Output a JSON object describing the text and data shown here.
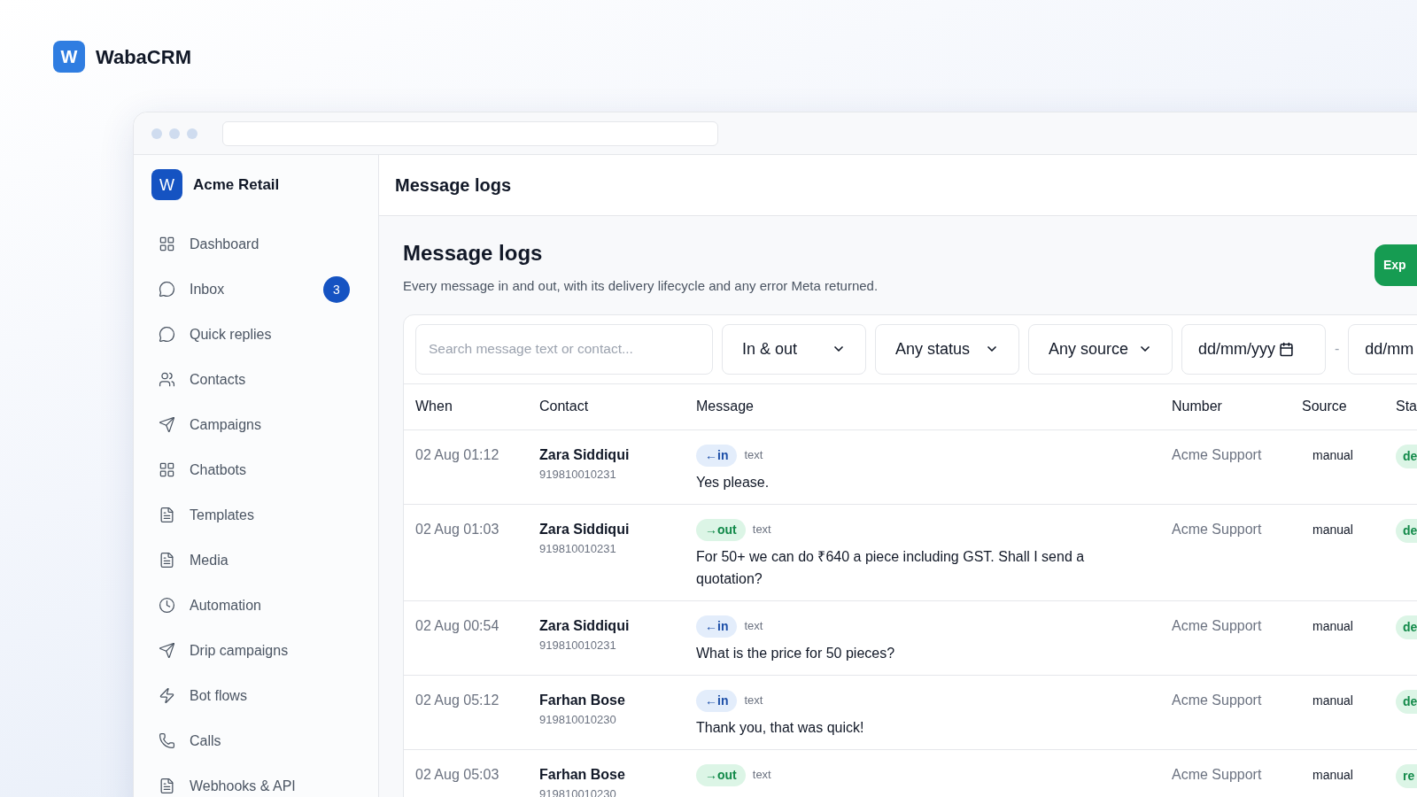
{
  "brand": {
    "name": "WabaCRM",
    "mark": "W"
  },
  "sidebar": {
    "workspace": {
      "mark": "W",
      "name": "Acme Retail"
    },
    "items": [
      {
        "label": "Dashboard",
        "kind": "grid"
      },
      {
        "label": "Inbox",
        "kind": "chat",
        "badge": "3"
      },
      {
        "label": "Quick replies",
        "kind": "chat"
      },
      {
        "label": "Contacts",
        "kind": "users"
      },
      {
        "label": "Campaigns",
        "kind": "send"
      },
      {
        "label": "Chatbots",
        "kind": "grid"
      },
      {
        "label": "Templates",
        "kind": "file"
      },
      {
        "label": "Media",
        "kind": "file"
      },
      {
        "label": "Automation",
        "kind": "clock"
      },
      {
        "label": "Drip campaigns",
        "kind": "send"
      },
      {
        "label": "Bot flows",
        "kind": "zap"
      },
      {
        "label": "Calls",
        "kind": "phone"
      },
      {
        "label": "Webhooks & API",
        "kind": "file"
      }
    ]
  },
  "topbar": {
    "title": "Message logs"
  },
  "page": {
    "title": "Message logs",
    "subtitle": "Every message in and out, with its delivery lifecycle and any error Meta returned.",
    "export_button": "Exp"
  },
  "filters": {
    "search": {
      "placeholder": "Search message text or contact..."
    },
    "selects": [
      "In & out",
      "Any status",
      "Any source"
    ],
    "date_from": "dd/mm/yyy",
    "separator": "-",
    "date_to": "dd/mm"
  },
  "table": {
    "columns": [
      "When",
      "Contact",
      "Message",
      "Number",
      "Source",
      "Sta"
    ],
    "rows": [
      {
        "when": "02 Aug 01:12",
        "contact": "Zara Siddiqui",
        "phone": "919810010231",
        "direction": {
          "kind": "in",
          "label": "←in"
        },
        "type": "text",
        "message": "Yes please.",
        "number": "Acme Support",
        "source": "manual",
        "status": "de"
      },
      {
        "when": "02 Aug 01:03",
        "contact": "Zara Siddiqui",
        "phone": "919810010231",
        "direction": {
          "kind": "out",
          "label": "→out"
        },
        "type": "text",
        "message": "For 50+ we can do ₹640 a piece including GST. Shall I send a quotation?",
        "number": "Acme Support",
        "source": "manual",
        "status": "de"
      },
      {
        "when": "02 Aug 00:54",
        "contact": "Zara Siddiqui",
        "phone": "919810010231",
        "direction": {
          "kind": "in",
          "label": "←in"
        },
        "type": "text",
        "message": "What is the price for 50 pieces?",
        "number": "Acme Support",
        "source": "manual",
        "status": "de"
      },
      {
        "when": "02 Aug 05:12",
        "contact": "Farhan Bose",
        "phone": "919810010230",
        "direction": {
          "kind": "in",
          "label": "←in"
        },
        "type": "text",
        "message": "Thank you, that was quick!",
        "number": "Acme Support",
        "source": "manual",
        "status": "de"
      },
      {
        "when": "02 Aug 05:03",
        "contact": "Farhan Bose",
        "phone": "919810010230",
        "direction": {
          "kind": "out",
          "label": "→out"
        },
        "type": "text",
        "number": "Acme Support",
        "source": "manual",
        "status": "re"
      }
    ]
  }
}
